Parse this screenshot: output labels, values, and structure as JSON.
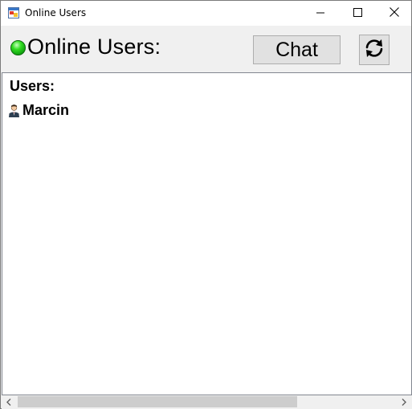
{
  "window": {
    "title": "Online Users",
    "icons": {
      "app": "app-window-icon",
      "minimize": "minimize-icon",
      "maximize": "maximize-icon",
      "close": "close-icon"
    }
  },
  "header": {
    "status_color": "#22cc22",
    "title": "Online Users:",
    "chat_label": "Chat",
    "refresh_icon": "refresh-icon"
  },
  "users_panel": {
    "label": "Users:",
    "users": [
      {
        "name": "Marcin",
        "icon": "user-avatar-icon"
      }
    ]
  },
  "scrollbar": {
    "orientation": "horizontal",
    "thumb_fraction": 0.69
  }
}
